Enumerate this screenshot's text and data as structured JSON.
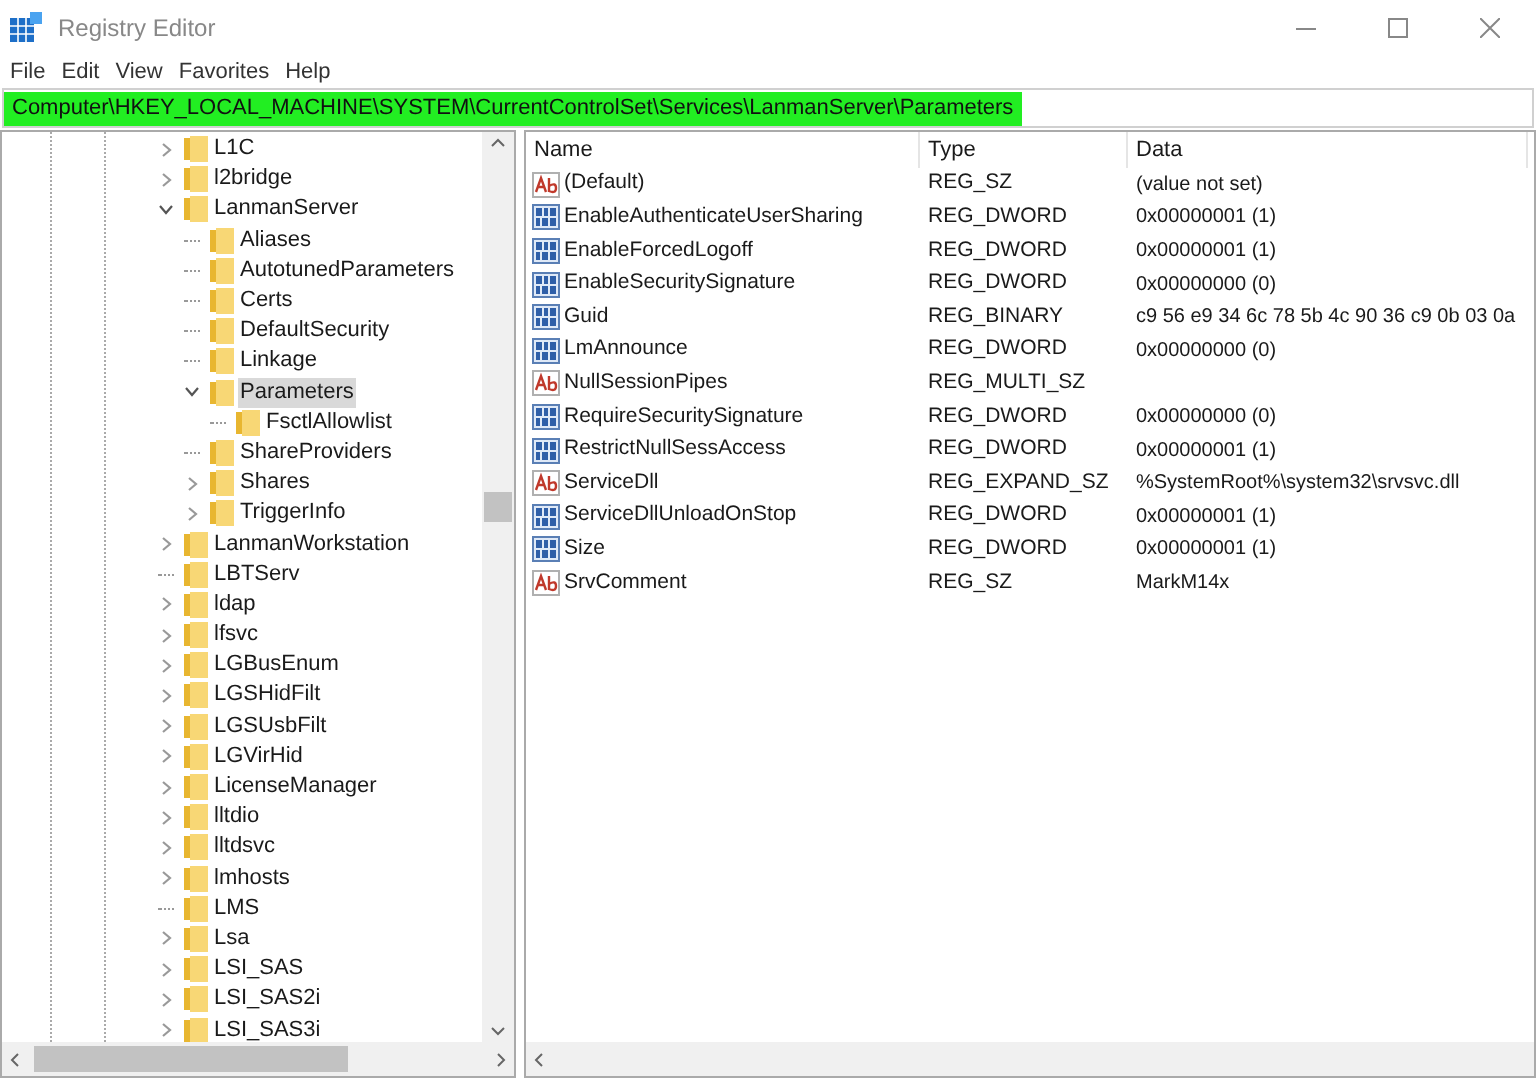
{
  "window": {
    "title": "Registry Editor"
  },
  "menu": [
    "File",
    "Edit",
    "View",
    "Favorites",
    "Help"
  ],
  "address": "Computer\\HKEY_LOCAL_MACHINE\\SYSTEM\\CurrentControlSet\\Services\\LanmanServer\\Parameters",
  "tree": [
    {
      "label": "L1C",
      "expanded": false,
      "selected": false
    },
    {
      "label": "l2bridge",
      "expanded": false,
      "selected": false
    },
    {
      "label": "LanmanServer",
      "expanded": true,
      "selected": false,
      "children": [
        {
          "label": "Aliases",
          "selected": false
        },
        {
          "label": "AutotunedParameters",
          "selected": false
        },
        {
          "label": "Certs",
          "selected": false
        },
        {
          "label": "DefaultSecurity",
          "selected": false
        },
        {
          "label": "Linkage",
          "selected": false
        },
        {
          "label": "Parameters",
          "expanded": true,
          "selected": true,
          "children": [
            {
              "label": "FsctlAllowlist",
              "selected": false
            }
          ]
        },
        {
          "label": "ShareProviders",
          "selected": false
        },
        {
          "label": "Shares",
          "expanded": false,
          "selected": false
        },
        {
          "label": "TriggerInfo",
          "expanded": false,
          "selected": false
        }
      ]
    },
    {
      "label": "LanmanWorkstation",
      "expanded": false,
      "selected": false
    },
    {
      "label": "LBTServ",
      "selected": false
    },
    {
      "label": "ldap",
      "expanded": false,
      "selected": false
    },
    {
      "label": "lfsvc",
      "expanded": false,
      "selected": false
    },
    {
      "label": "LGBusEnum",
      "expanded": false,
      "selected": false
    },
    {
      "label": "LGSHidFilt",
      "expanded": false,
      "selected": false
    },
    {
      "label": "LGSUsbFilt",
      "expanded": false,
      "selected": false
    },
    {
      "label": "LGVirHid",
      "expanded": false,
      "selected": false
    },
    {
      "label": "LicenseManager",
      "expanded": false,
      "selected": false
    },
    {
      "label": "lltdio",
      "expanded": false,
      "selected": false
    },
    {
      "label": "lltdsvc",
      "expanded": false,
      "selected": false
    },
    {
      "label": "lmhosts",
      "expanded": false,
      "selected": false
    },
    {
      "label": "LMS",
      "selected": false
    },
    {
      "label": "Lsa",
      "expanded": false,
      "selected": false
    },
    {
      "label": "LSI_SAS",
      "expanded": false,
      "selected": false
    },
    {
      "label": "LSI_SAS2i",
      "expanded": false,
      "selected": false
    },
    {
      "label": "LSI_SAS3i",
      "expanded": false,
      "selected": false
    }
  ],
  "table": {
    "columns": [
      "Name",
      "Type",
      "Data"
    ],
    "rows": [
      {
        "kind": "string",
        "name": "(Default)",
        "type": "REG_SZ",
        "data": "(value not set)"
      },
      {
        "kind": "binary",
        "name": "EnableAuthenticateUserSharing",
        "type": "REG_DWORD",
        "data": "0x00000001 (1)"
      },
      {
        "kind": "binary",
        "name": "EnableForcedLogoff",
        "type": "REG_DWORD",
        "data": "0x00000001 (1)"
      },
      {
        "kind": "binary",
        "name": "EnableSecuritySignature",
        "type": "REG_DWORD",
        "data": "0x00000000 (0)"
      },
      {
        "kind": "binary",
        "name": "Guid",
        "type": "REG_BINARY",
        "data": "c9 56 e9 34 6c 78 5b 4c 90 36 c9 0b 03 0a"
      },
      {
        "kind": "binary",
        "name": "LmAnnounce",
        "type": "REG_DWORD",
        "data": "0x00000000 (0)"
      },
      {
        "kind": "string",
        "name": "NullSessionPipes",
        "type": "REG_MULTI_SZ"
      },
      {
        "kind": "binary",
        "name": "RequireSecuritySignature",
        "type": "REG_DWORD",
        "data": "0x00000000 (0)"
      },
      {
        "kind": "binary",
        "name": "RestrictNullSessAccess",
        "type": "REG_DWORD",
        "data": "0x00000001 (1)"
      },
      {
        "kind": "string",
        "name": "ServiceDll",
        "type": "REG_EXPAND_SZ",
        "data": "%SystemRoot%\\system32\\srvsvc.dll"
      },
      {
        "kind": "binary",
        "name": "ServiceDllUnloadOnStop",
        "type": "REG_DWORD",
        "data": "0x00000001 (1)"
      },
      {
        "kind": "binary",
        "name": "Size",
        "type": "REG_DWORD",
        "data": "0x00000001 (1)"
      },
      {
        "kind": "string",
        "name": "SrvComment",
        "type": "REG_SZ",
        "data": "MarkM14x"
      }
    ]
  }
}
